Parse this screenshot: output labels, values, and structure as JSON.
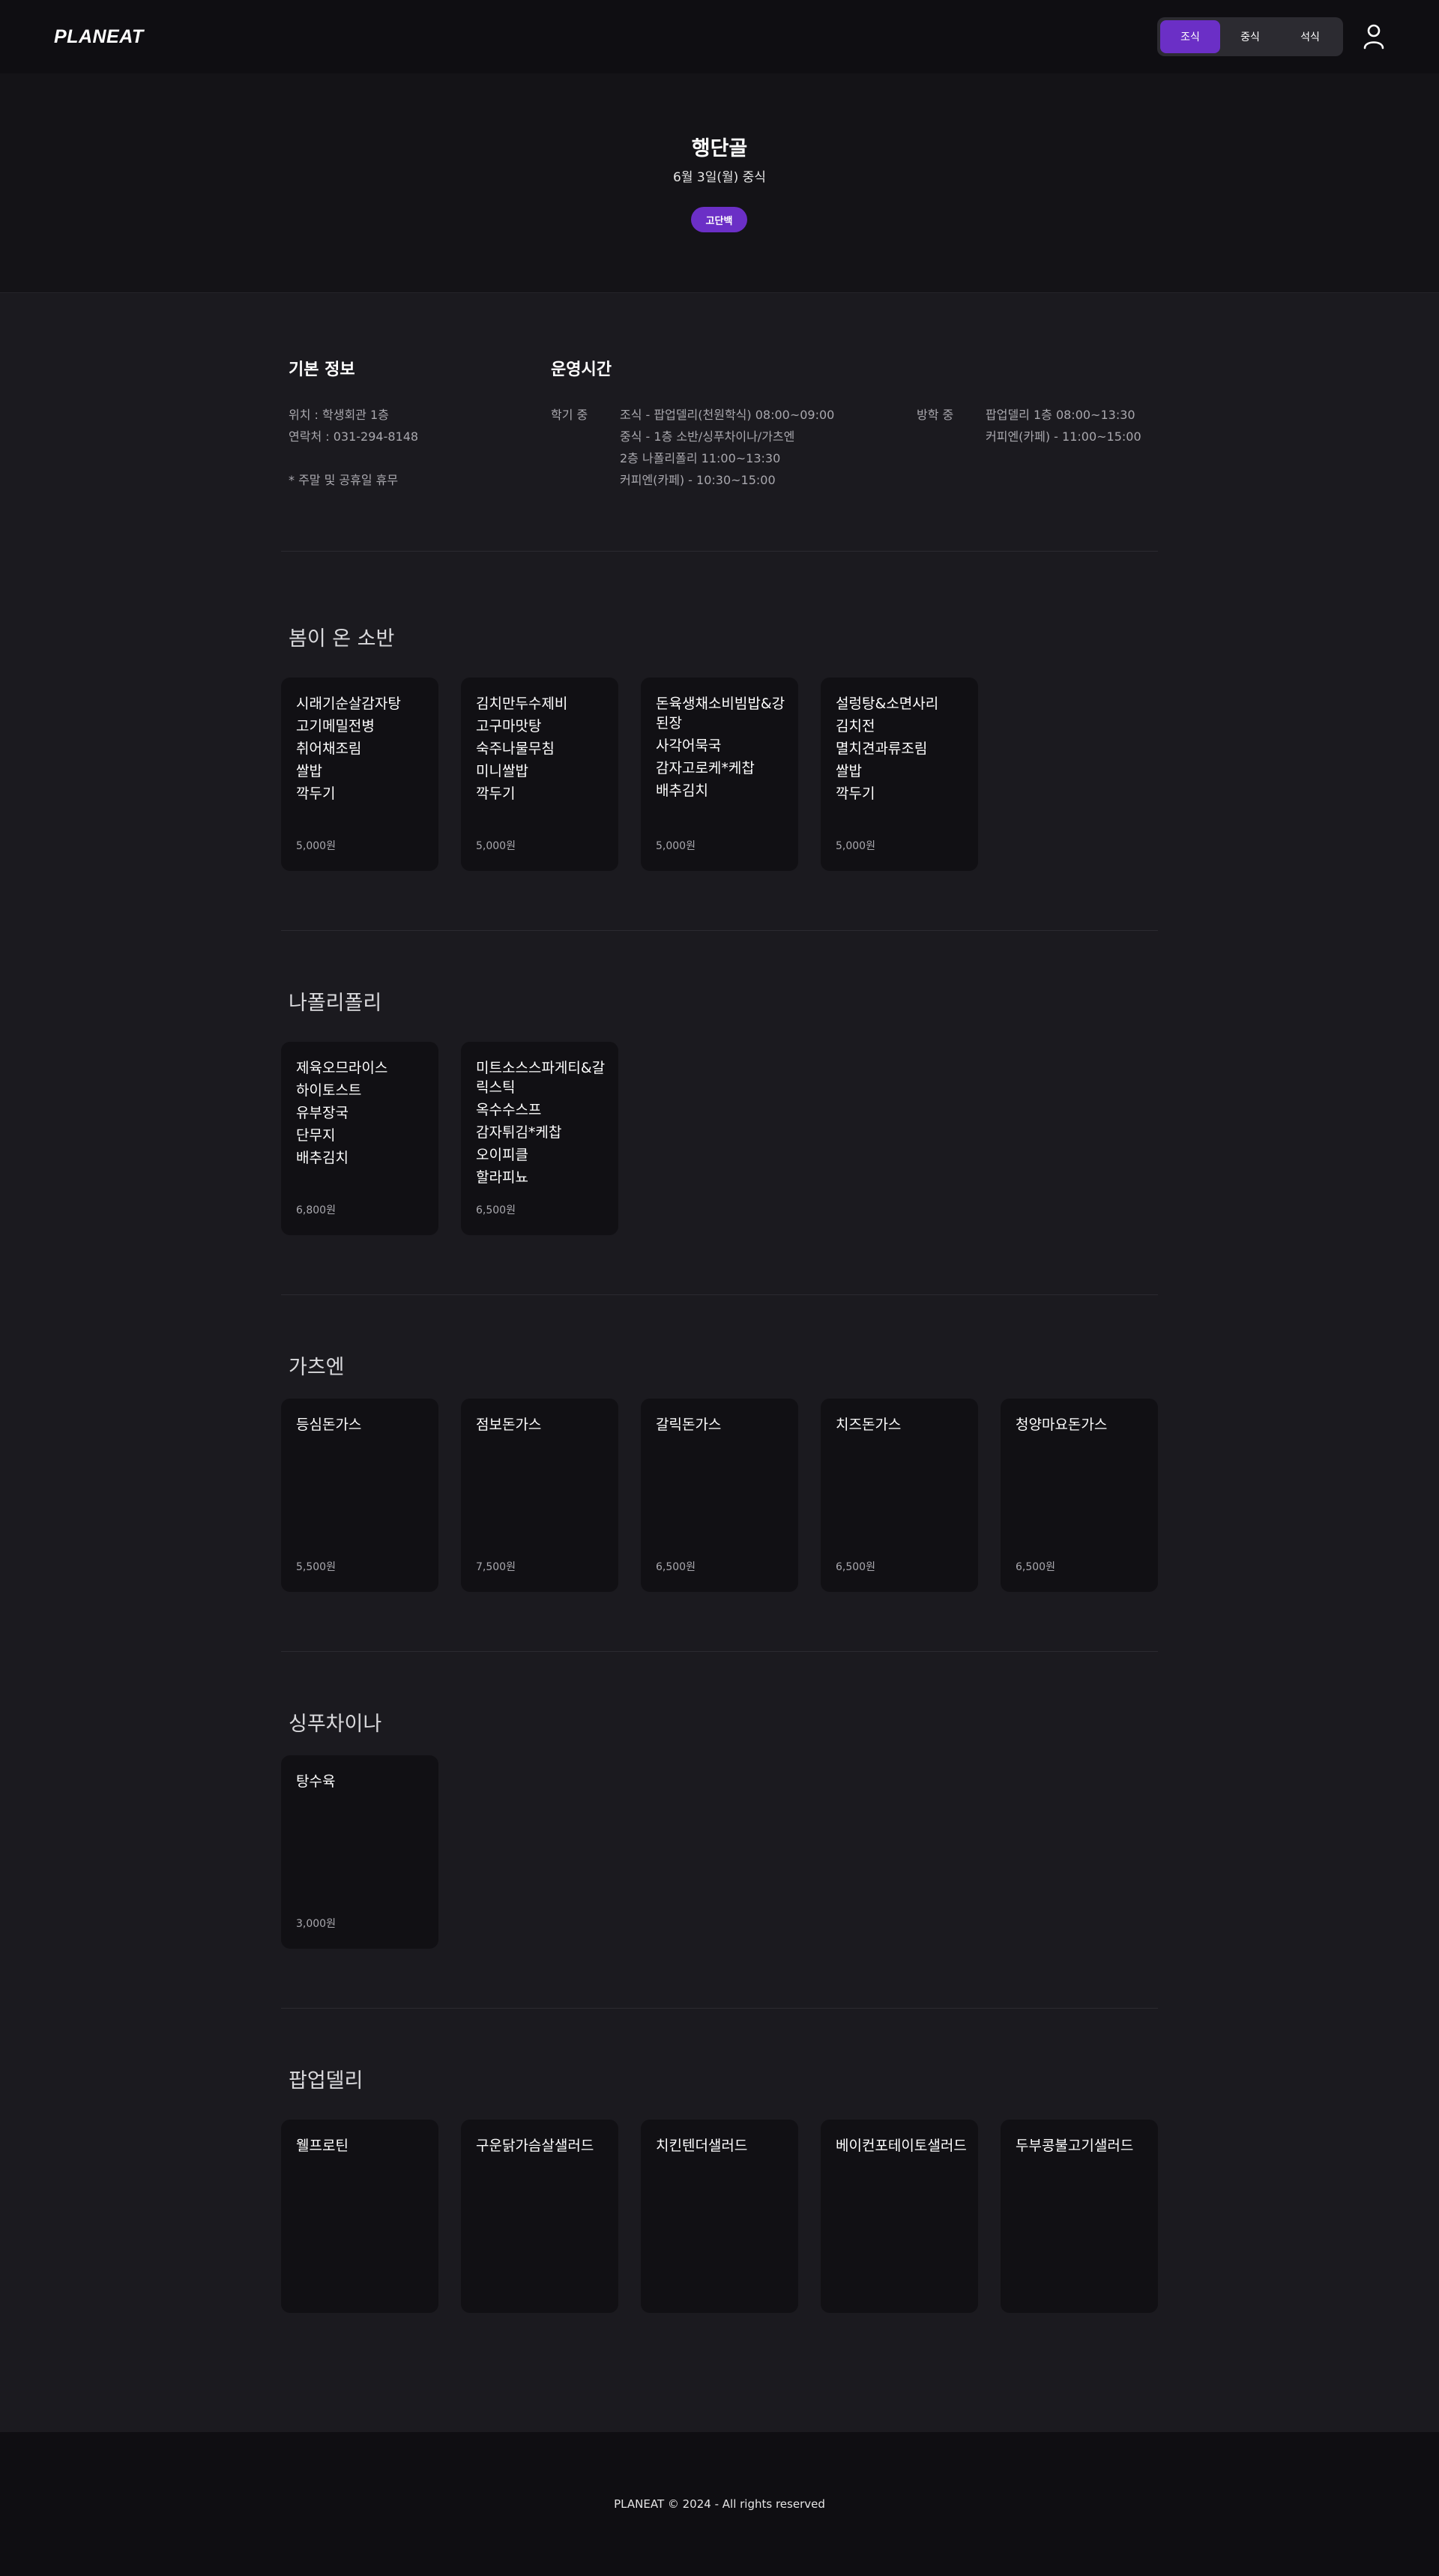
{
  "header": {
    "logo": "PLANEAT",
    "tabs": [
      "조식",
      "중식",
      "석식"
    ],
    "active_tab": 0,
    "user_icon": "user-icon"
  },
  "hero": {
    "title": "행단골",
    "date": "6월 3일(월) 중식",
    "badge": "고단백"
  },
  "basic_info": {
    "heading": "기본 정보",
    "location": "위치 : 학생회관 1층",
    "contact": "연락처 : 031-294-8148",
    "note": "* 주말 및 공휴일 휴무"
  },
  "hours": {
    "heading": "운영시간",
    "semester_label": "학기 중",
    "semester_lines": [
      "조식 - 팝업델리(천원학식) 08:00~09:00",
      "중식 - 1층 소반/싱푸차이나/가츠엔",
      "2층 나폴리폴리 11:00~13:30",
      "커피엔(카페) - 10:30~15:00"
    ],
    "vacation_label": "방학 중",
    "vacation_lines": [
      "팝업델리 1층 08:00~13:30",
      "커피엔(카페) - 11:00~15:00"
    ]
  },
  "sections": [
    {
      "title": "봄이 온 소반",
      "cards": [
        {
          "menu": [
            "시래기순살감자탕",
            "고기메밀전병",
            "취어채조림",
            "쌀밥",
            "깍두기"
          ],
          "price": "5,000원"
        },
        {
          "menu": [
            "김치만두수제비",
            "고구마맛탕",
            "숙주나물무침",
            "미니쌀밥",
            "깍두기"
          ],
          "price": "5,000원"
        },
        {
          "menu": [
            "돈육생채소비빔밥&강된장",
            "사각어묵국",
            "감자고로케*케찹",
            "배추김치"
          ],
          "price": "5,000원"
        },
        {
          "menu": [
            "설렁탕&소면사리",
            "김치전",
            "멸치견과류조림",
            "쌀밥",
            "깍두기"
          ],
          "price": "5,000원"
        }
      ]
    },
    {
      "title": "나폴리폴리",
      "cards": [
        {
          "menu": [
            "제육오므라이스",
            "하이토스트",
            "유부장국",
            "단무지",
            "배추김치"
          ],
          "price": "6,800원"
        },
        {
          "menu": [
            "미트소스스파게티&갈릭스틱",
            "옥수수스프",
            "감자튀김*케찹",
            "오이피클",
            "할라피뇨"
          ],
          "price": "6,500원"
        }
      ]
    },
    {
      "title": "가츠엔",
      "cards": [
        {
          "menu": [
            "등심돈가스"
          ],
          "price": "5,500원"
        },
        {
          "menu": [
            "점보돈가스"
          ],
          "price": "7,500원"
        },
        {
          "menu": [
            "갈릭돈가스"
          ],
          "price": "6,500원"
        },
        {
          "menu": [
            "치즈돈가스"
          ],
          "price": "6,500원"
        },
        {
          "menu": [
            "청양마요돈가스"
          ],
          "price": "6,500원"
        }
      ]
    },
    {
      "title": "싱푸차이나",
      "cards": [
        {
          "menu": [
            "탕수육"
          ],
          "price": "3,000원"
        }
      ]
    },
    {
      "title": "팝업델리",
      "cards": [
        {
          "menu": [
            "웰프로틴"
          ],
          "price": ""
        },
        {
          "menu": [
            "구운닭가슴살샐러드"
          ],
          "price": ""
        },
        {
          "menu": [
            "치킨텐더샐러드"
          ],
          "price": ""
        },
        {
          "menu": [
            "베이컨포테이토샐러드"
          ],
          "price": ""
        },
        {
          "menu": [
            "두부콩불고기샐러드"
          ],
          "price": ""
        }
      ]
    }
  ],
  "footer": {
    "text": "PLANEAT © 2024 - All rights reserved"
  },
  "colors": {
    "accent": "#6b2fc6",
    "background": "#1b1a1f",
    "card": "#111014"
  }
}
